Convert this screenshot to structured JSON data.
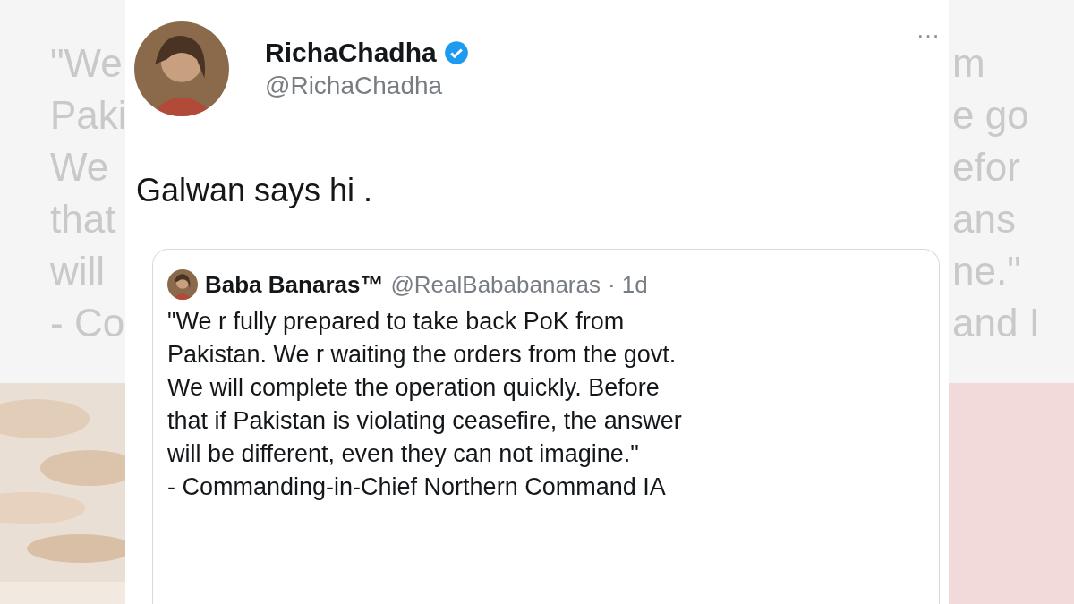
{
  "backdrop": {
    "left_fragments": [
      "\"We",
      "Paki",
      "We",
      "that",
      "will",
      "- Co"
    ],
    "right_fragments": [
      "m",
      "e go",
      "efor",
      "ans",
      "ne.\"",
      "and I"
    ]
  },
  "tweet": {
    "author": {
      "name": "RichaChadha",
      "verified": true,
      "handle": "@RichaChadha"
    },
    "more": "···",
    "text": "Galwan says hi .",
    "quote": {
      "author": {
        "name": "Baba Banaras™",
        "handle": "@RealBababanaras",
        "time": "· 1d"
      },
      "lines": [
        "\"We r fully prepared to take back PoK from",
        "Pakistan. We r waiting the orders from the govt.",
        "We will complete the operation quickly. Before",
        "that if Pakistan is violating ceasefire, the answer",
        "will be different, even they can not imagine.\"",
        "- Commanding-in-Chief Northern Command IA"
      ]
    }
  }
}
